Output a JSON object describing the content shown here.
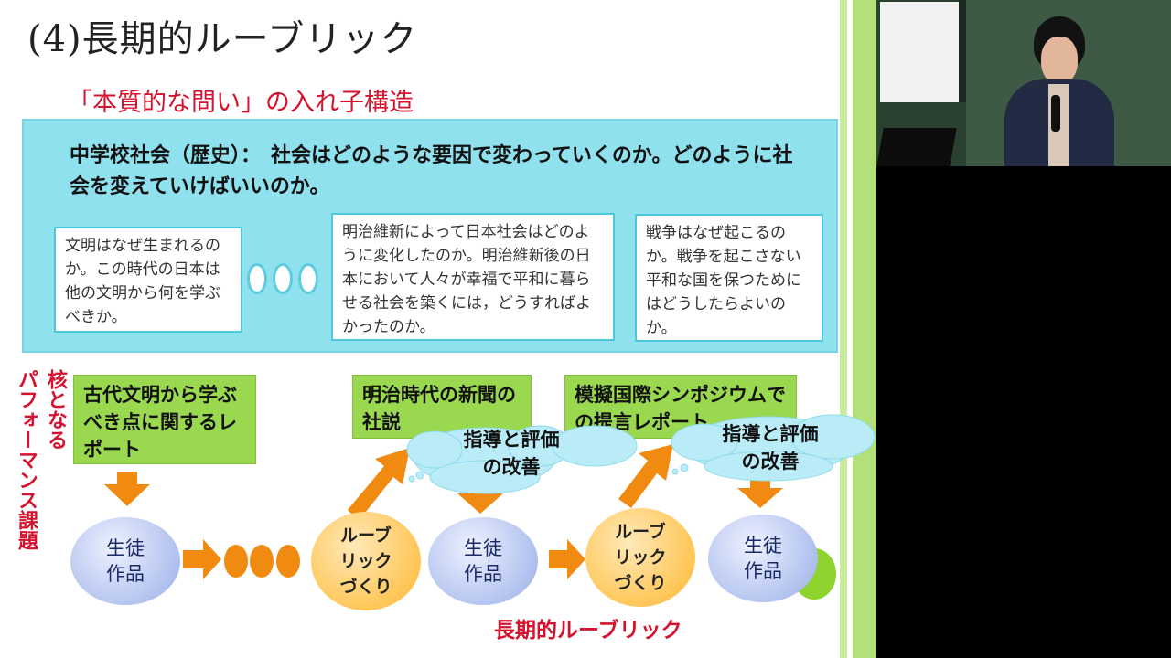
{
  "slide": {
    "title": "(4)長期的ルーブリック",
    "subtitle": "「本質的な問い」の入れ子構造",
    "core_question": "中学校社会（歴史）：　社会はどのような要因で変わっていくのか。どのように社会を変えていけばいいのか。",
    "sub_questions": [
      "文明はなぜ生まれるのか。この時代の日本は他の文明から何を学ぶべきか。",
      "明治維新によって日本社会はどのように変化したのか。明治維新後の日本において人々が幸福で平和に暮らせる社会を築くには，どうすればよかったのか。",
      "戦争はなぜ起こるのか。戦争を起こさない平和な国を保つためにはどうしたらよいのか。"
    ],
    "side_label_1": "核となる",
    "side_label_2": "パフォーマンス課題",
    "tasks": [
      "古代文明から学ぶべき点に関するレポート",
      "明治時代の新聞の社説",
      "模擬国際シンポジウムでの提言レポート"
    ],
    "improvement": "指導と評価の改善",
    "student_work": "生徒作品",
    "rubric_making": "ルーブリックづくり",
    "bottom_label": "長期的ルーブリック"
  }
}
